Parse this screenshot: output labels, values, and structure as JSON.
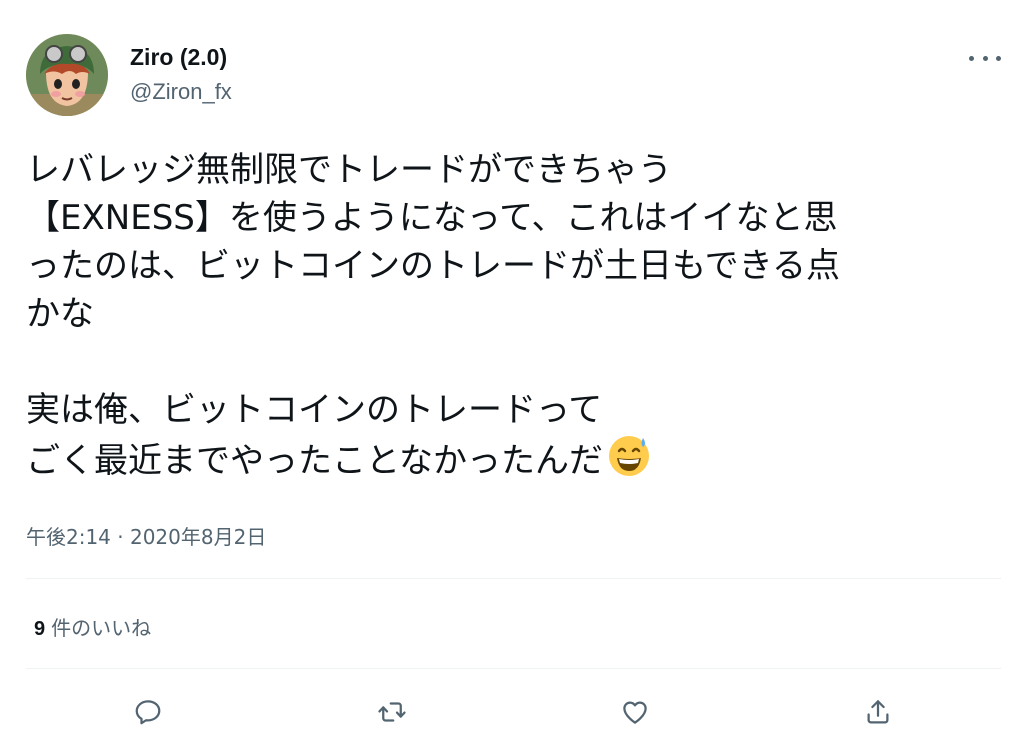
{
  "author": {
    "name": "Ziro (2.0)",
    "handle": "@Ziron_fx",
    "avatar_icon": "anime-character-avatar"
  },
  "menu_icon": "more-options-icon",
  "tweet": {
    "text": "レバレッジ無制限でトレードができちゃう\n【EXNESS】を使うようになって、これはイイなと思\nったのは、ビットコインのトレードが土日もできる点\nかな\n\n実は俺、ビットコインのトレードって\nごく最近までやったことなかったんだ",
    "emoji": "grinning-face-with-sweat-emoji"
  },
  "timestamp": "午後2:14 · 2020年8月2日",
  "likes": {
    "count": "9",
    "label": "件のいいね"
  },
  "actions": [
    {
      "name": "reply",
      "icon": "reply-icon"
    },
    {
      "name": "retweet",
      "icon": "retweet-icon"
    },
    {
      "name": "like",
      "icon": "heart-icon"
    },
    {
      "name": "share",
      "icon": "share-icon"
    }
  ],
  "colors": {
    "text": "#0f1419",
    "secondary": "#536471",
    "divider": "#eff3f4",
    "emoji_face": "#ffcc4d"
  }
}
